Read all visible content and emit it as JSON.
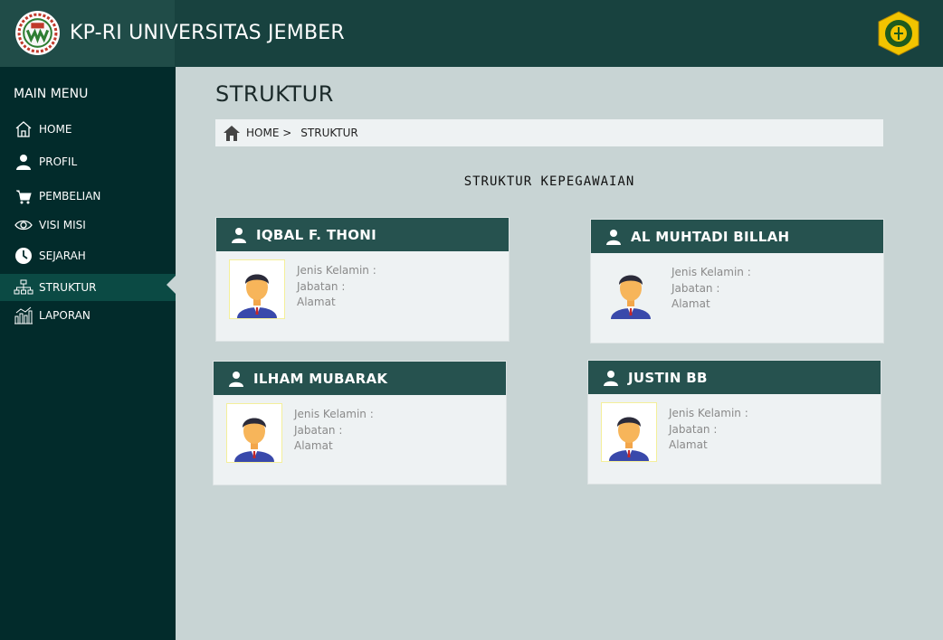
{
  "header": {
    "title": "KP-RI UNIVERSITAS JEMBER"
  },
  "sidebar": {
    "menu_title": "MAIN MENU",
    "items": [
      {
        "label": "HOME",
        "icon": "home-icon"
      },
      {
        "label": "PROFIL",
        "icon": "user-icon"
      },
      {
        "label": "PEMBELIAN",
        "icon": "cart-icon"
      },
      {
        "label": "VISI MISI",
        "icon": "eye-icon"
      },
      {
        "label": "SEJARAH",
        "icon": "clock-icon"
      },
      {
        "label": "STRUKTUR",
        "icon": "hierarchy-icon"
      },
      {
        "label": "LAPORAN",
        "icon": "chart-icon"
      }
    ]
  },
  "main": {
    "page_title": "STRUKTUR",
    "breadcrumb": {
      "home": "HOME >",
      "current": "STRUKTUR"
    },
    "section_title": "STRUKTUR KEPEGAWAIAN",
    "cards": [
      {
        "name": "IQBAL F. THONI",
        "gender_label": "Jenis Kelamin :",
        "position_label": "Jabatan :",
        "address_label": "Alamat"
      },
      {
        "name": "AL MUHTADI BILLAH",
        "gender_label": "Jenis Kelamin :",
        "position_label": "Jabatan :",
        "address_label": "Alamat"
      },
      {
        "name": "ILHAM MUBARAK",
        "gender_label": "Jenis Kelamin :",
        "position_label": "Jabatan :",
        "address_label": "Alamat"
      },
      {
        "name": "JUSTIN BB",
        "gender_label": "Jenis Kelamin :",
        "position_label": "Jabatan :",
        "address_label": "Alamat"
      }
    ]
  },
  "colors": {
    "header": "#18423f",
    "sidebar": "#022b2b",
    "active": "#0b4a44",
    "card_head": "#26524f",
    "background": "#c8d4d4"
  }
}
